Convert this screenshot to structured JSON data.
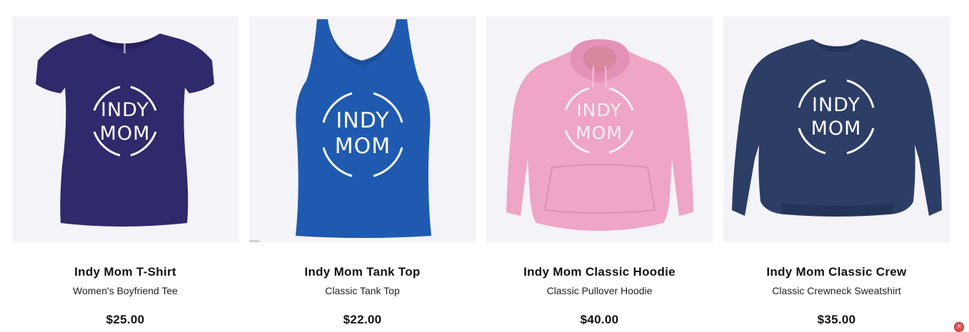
{
  "products": [
    {
      "title": "Indy Mom T-Shirt",
      "subtitle": "Women's Boyfriend Tee",
      "price": "$25.00",
      "garment": "t-shirt",
      "color": "#2e2a6b",
      "logo_color": "#ffffff",
      "logo_lines": [
        "INDY",
        "MOM"
      ]
    },
    {
      "title": "Indy Mom Tank Top",
      "subtitle": "Classic Tank Top",
      "price": "$22.00",
      "garment": "tank-top",
      "color": "#1f5ab0",
      "logo_color": "#ffffff",
      "logo_lines": [
        "INDY",
        "MOM"
      ]
    },
    {
      "title": "Indy Mom Classic Hoodie",
      "subtitle": "Classic Pullover Hoodie",
      "price": "$40.00",
      "garment": "hoodie",
      "color": "#eea5c6",
      "logo_color": "#f8f0f6",
      "logo_lines": [
        "INDY",
        "MOM"
      ]
    },
    {
      "title": "Indy Mom Classic Crew",
      "subtitle": "Classic Crewneck Sweatshirt",
      "price": "$35.00",
      "garment": "crewneck",
      "color": "#2c3d66",
      "logo_color": "#ffffff",
      "logo_lines": [
        "INDY",
        "MOM"
      ]
    }
  ],
  "close_icon": "×",
  "colors": {
    "image_background": "#f4f3f8",
    "text": "#111111"
  }
}
